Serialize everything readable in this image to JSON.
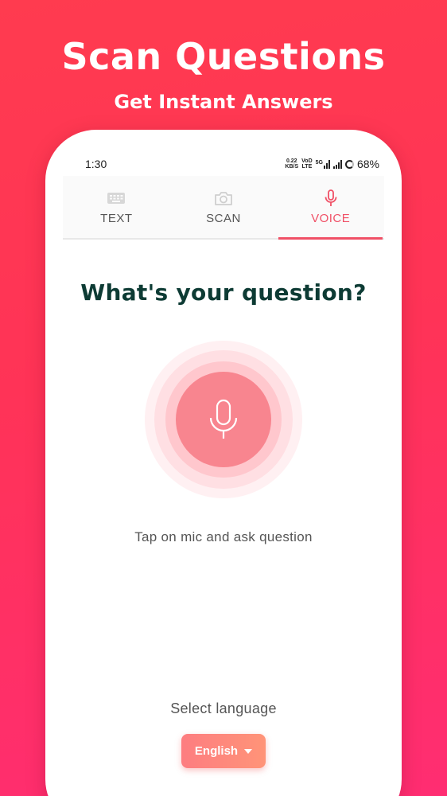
{
  "promo": {
    "title": "Scan Questions",
    "subtitle": "Get Instant Answers"
  },
  "status_bar": {
    "time": "1:30",
    "speed_value": "0.22",
    "speed_unit": "KB/S",
    "volte_top": "VoD",
    "volte_bottom": "LTE",
    "network": "5G",
    "battery": "68%"
  },
  "tabs": [
    {
      "label": "TEXT",
      "icon": "keyboard-icon",
      "active": false
    },
    {
      "label": "SCAN",
      "icon": "camera-icon",
      "active": false
    },
    {
      "label": "VOICE",
      "icon": "microphone-icon",
      "active": true
    }
  ],
  "main": {
    "question": "What's your question?",
    "hint": "Tap on mic and ask question",
    "select_language_label": "Select language",
    "language_selected": "English"
  },
  "colors": {
    "accent": "#f05066",
    "heading": "#0d3b34",
    "background_top": "#ff3b4f",
    "background_bottom": "#ff2d72",
    "mic_fill": "#f8858f"
  }
}
